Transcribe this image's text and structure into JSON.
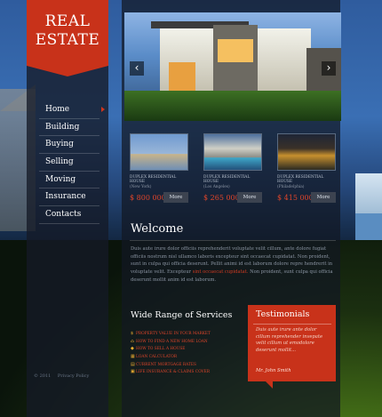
{
  "logo": {
    "line1": "REAL",
    "line2": "ESTATE"
  },
  "nav": {
    "items": [
      {
        "label": "Home",
        "active": true
      },
      {
        "label": "Building"
      },
      {
        "label": "Buying"
      },
      {
        "label": "Selling"
      },
      {
        "label": "Moving"
      },
      {
        "label": "Insurance"
      },
      {
        "label": "Contacts"
      }
    ]
  },
  "footer": {
    "copyright": "© 2011",
    "privacy": "Privacy Policy"
  },
  "slider": {
    "prev_icon": "‹",
    "next_icon": "›"
  },
  "listings": [
    {
      "title": "Duplex residential house",
      "location": "(New York)",
      "price": "$ 800 000",
      "more": "More"
    },
    {
      "title": "Duplex residential house",
      "location": "(Los Angeles)",
      "price": "$ 265 000",
      "more": "More"
    },
    {
      "title": "Duplex residential house",
      "location": "(Philadelphia)",
      "price": "$ 415 000",
      "more": "More"
    }
  ],
  "welcome": {
    "title": "Welcome",
    "body1": "Duis aute irure dolor officiis reprehenderit voluptate velit cillum, ante dolore fugiat officiis nostrum nisl ullamco laboris excepteur sint occaecat cupidatat. Non proident, sunt in culpa qui officia deserunt. Pellit animi id est laborum dolore repre hendrerit in voluptate velit. Excepteur",
    "highlight": "sint occaecat cupidatat.",
    "body2": "Non proident, sunt culpa qui officia deserunt mollit anim id est laborum."
  },
  "services": {
    "title": "Wide Range of Services",
    "items": [
      "Property value in your market",
      "How to find a new home loan",
      "How to sell a house",
      "Loan calculator",
      "Current mortgage rates",
      "Life insurance & claims cover"
    ]
  },
  "testimonials": {
    "title": "Testimonials",
    "body": "Duis aute irure ante dolor cillum reprehender invepate velit cillum ut emodolore deserunt mollit...",
    "author": "Mr. John Smith"
  },
  "colors": {
    "accent": "#c8321a",
    "price": "#e0452a"
  }
}
